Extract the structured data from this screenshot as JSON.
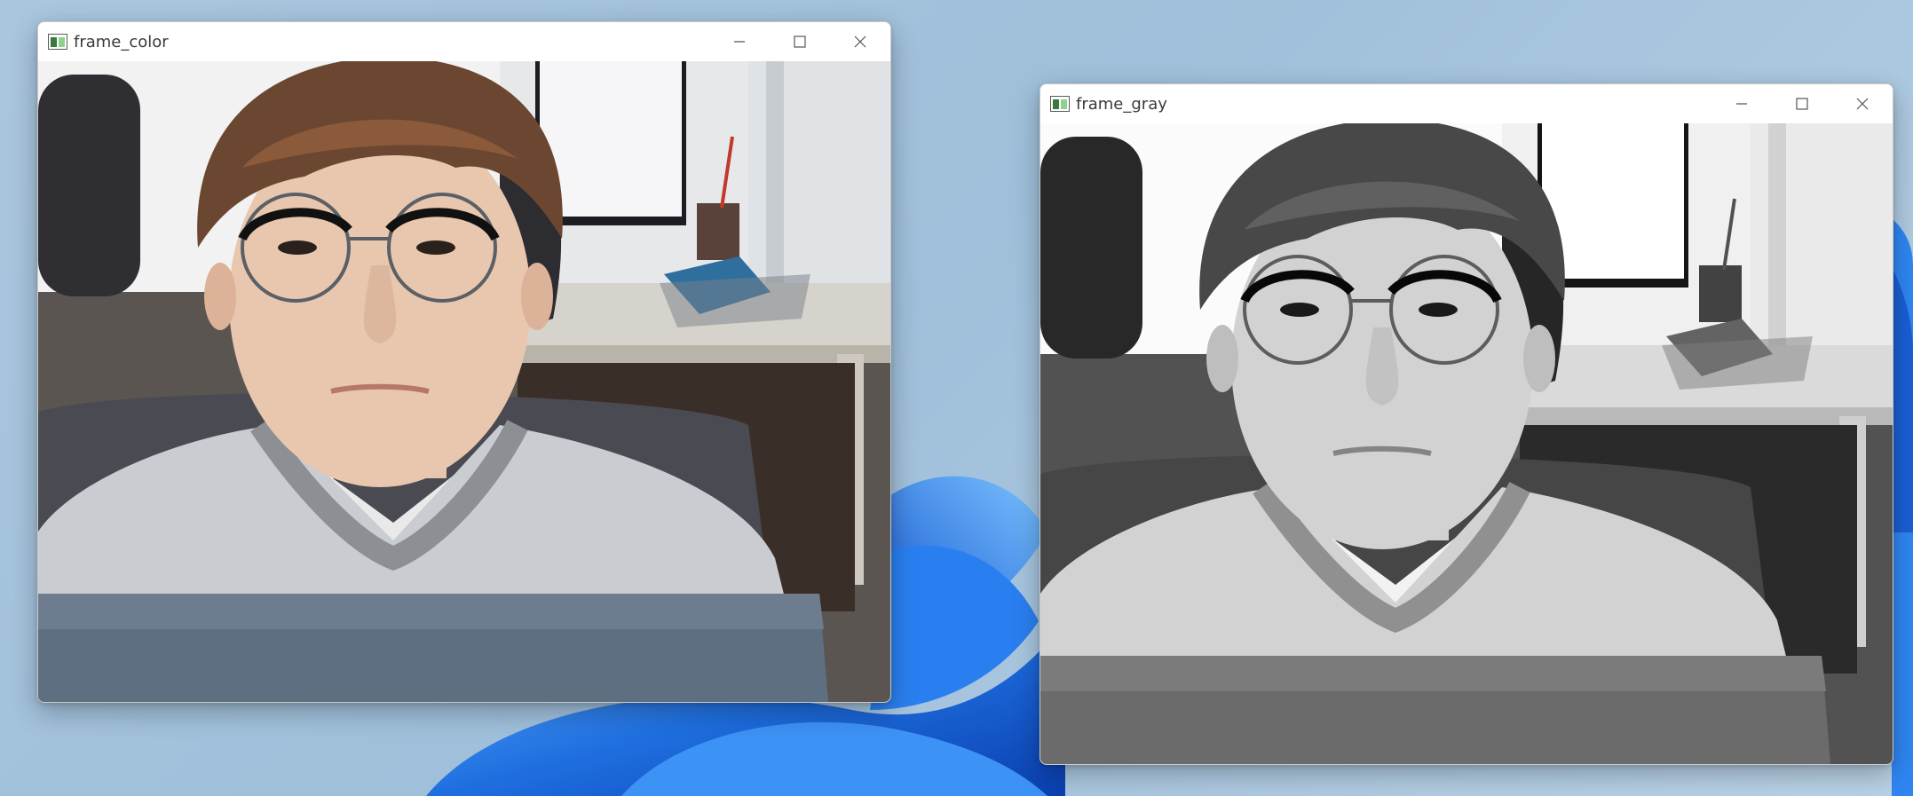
{
  "windows": [
    {
      "title": "frame_color",
      "icon": "opencv-window-icon",
      "controls": [
        "minimize-icon",
        "maximize-icon",
        "close-icon"
      ]
    },
    {
      "title": "frame_gray",
      "icon": "opencv-window-icon",
      "controls": [
        "minimize-icon",
        "maximize-icon",
        "close-icon"
      ]
    }
  ],
  "colors": {
    "wallpaper_blue": "#1f6fe0",
    "sweater_light": "#c9ccd1",
    "sweater_dark": "#5e6f82",
    "hair": "#6b4630"
  }
}
